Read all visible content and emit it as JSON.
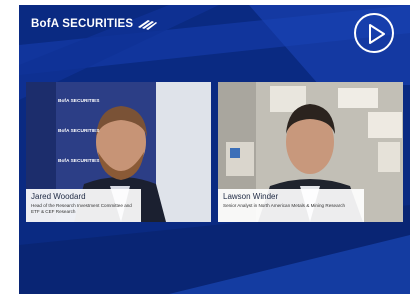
{
  "header": {
    "brand_text": "BofA SECURITIES",
    "brand_icon": "bofa-flag-icon",
    "play_icon": "play-icon"
  },
  "panels": [
    {
      "name": "Jared Woodard",
      "title": "Head of the Research Investment Committee and ETF & CEF Research",
      "backdrop_text": "BofA SECURITIES"
    },
    {
      "name": "Lawson Winder",
      "title": "Senior Analyst in North American Metals & Mining Research"
    }
  ],
  "colors": {
    "background": "#0a2a82",
    "stripe": "#1f4fc4",
    "caption_bg": "#ffffff"
  }
}
